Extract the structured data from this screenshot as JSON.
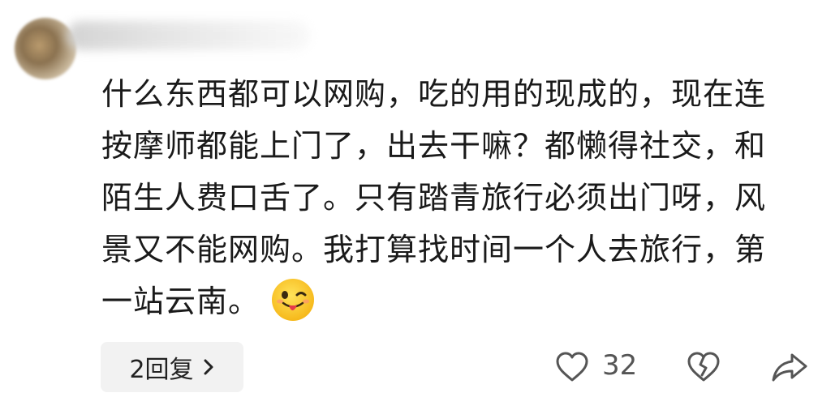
{
  "comment": {
    "lines": [
      "什么东西都可以网购，吃的用的现成的，现在连",
      "按摩师都能上门了，出去干嘛？都懒得社交，和",
      "陌生人费口舌了。只有踏青旅行必须出门呀，风",
      "景又不能网购。我打算找时间一个人去旅行，第",
      "一站云南。"
    ],
    "emoji": "winking-tongue-emoji"
  },
  "actions": {
    "reply_label": "2回复",
    "like_count": "32"
  },
  "icons": {
    "like": "heart-icon",
    "dislike": "broken-heart-icon",
    "share": "share-arrow-icon",
    "chevron": "chevron-right-icon"
  }
}
